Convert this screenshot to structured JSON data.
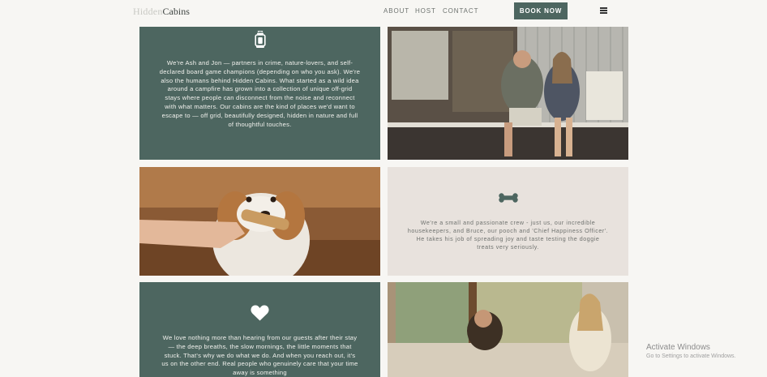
{
  "header": {
    "logo_part1": "Hidden",
    "logo_part2": "Cabins",
    "nav": [
      "ABOUT",
      "HOST",
      "CONTACT"
    ],
    "cta": "BOOK NOW",
    "menu_icon": "hamburger-menu-icon"
  },
  "sections": {
    "about_text": "We're Ash and Jon — partners in crime, nature-lovers, and self-declared board game champions (depending on who you ask). We're also the humans behind Hidden Cabins. What started as a wild idea around a campfire has grown into a collection of unique off-grid stays where people can disconnect from the noise and reconnect with what matters. Our cabins are the kind of places we'd want to escape to — off grid, beautifully designed, hidden in nature and full of thoughtful touches.",
    "about_icon": "lantern-icon",
    "crew_text": "We're a small and passionate crew - just us, our incredible housekeepers, and Bruce, our pooch and 'Chief Happiness Officer'. He takes his job of spreading joy and taste testing the doggie treats very seriously.",
    "crew_icon": "bone-icon",
    "guests_text": "We love nothing more than hearing from our guests after their stay — the deep breaths, the slow mornings, the little moments that stuck. That's why we do what we do. And when you reach out, it's us on the other end. Real people who genuinely care that your time away is something",
    "guests_icon": "heart-icon"
  },
  "colors": {
    "green": "#4d6660",
    "beige": "#e8e2dd",
    "background": "#f7f6f3"
  },
  "overlay": {
    "line1": "Activate Windows",
    "line2": "Go to Settings to activate Windows."
  }
}
